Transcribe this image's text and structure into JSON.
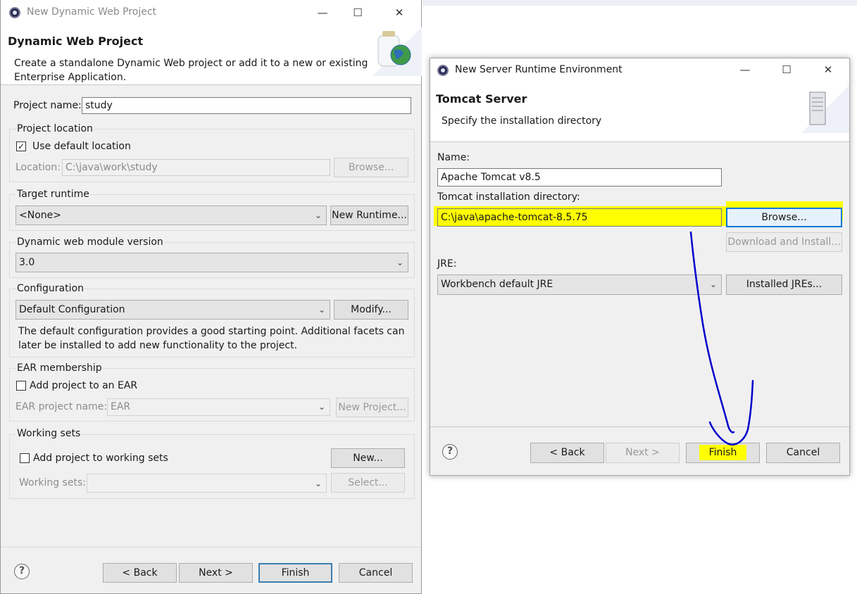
{
  "dialog1": {
    "title": "New Dynamic Web Project",
    "heading": "Dynamic Web Project",
    "description": "Create a standalone Dynamic Web project or add it to a new or existing Enterprise Application.",
    "project_name_label": "Project name:",
    "project_name_value": "study",
    "project_location": {
      "group_label": "Project location",
      "use_default_label": "Use default location",
      "use_default_checked": true,
      "location_label": "Location:",
      "location_value": "C:\\java\\work\\study",
      "browse_label": "Browse..."
    },
    "target_runtime": {
      "group_label": "Target runtime",
      "selected": "<None>",
      "new_runtime_label": "New Runtime..."
    },
    "module_version": {
      "group_label": "Dynamic web module version",
      "selected": "3.0"
    },
    "configuration": {
      "group_label": "Configuration",
      "selected": "Default Configuration",
      "modify_label": "Modify...",
      "info_text": "The default configuration provides a good starting point. Additional facets can later be installed to add new functionality to the project."
    },
    "ear_membership": {
      "group_label": "EAR membership",
      "add_to_ear_label": "Add project to an EAR",
      "ear_name_label": "EAR project name:",
      "ear_name_value": "EAR",
      "new_project_label": "New Project..."
    },
    "working_sets": {
      "group_label": "Working sets",
      "add_label": "Add project to working sets",
      "new_label": "New...",
      "sets_label": "Working sets:",
      "select_label": "Select..."
    },
    "buttons": {
      "back": "< Back",
      "next": "Next >",
      "finish": "Finish",
      "cancel": "Cancel"
    }
  },
  "dialog2": {
    "title": "New Server Runtime Environment",
    "heading": "Tomcat Server",
    "description": "Specify the installation directory",
    "name_label": "Name:",
    "name_value": "Apache Tomcat v8.5",
    "install_dir_label": "Tomcat installation directory:",
    "install_dir_value": "C:\\java\\apache-tomcat-8.5.75",
    "browse_label": "Browse...",
    "download_label": "Download and Install...",
    "jre_label": "JRE:",
    "jre_selected": "Workbench default JRE",
    "installed_jres_label": "Installed JREs...",
    "buttons": {
      "back": "< Back",
      "next": "Next >",
      "finish": "Finish",
      "cancel": "Cancel"
    }
  },
  "icons": {
    "app": "eclipse-icon",
    "minimize": "minimize-icon",
    "maximize": "maximize-icon",
    "close": "close-icon",
    "help": "help-icon",
    "chevron": "chevron-down-icon",
    "banner1": "web-project-globe-icon",
    "banner2": "server-tower-icon"
  },
  "annotations": {
    "highlight_color": "#ffff00",
    "pen_color": "#0000cc"
  }
}
